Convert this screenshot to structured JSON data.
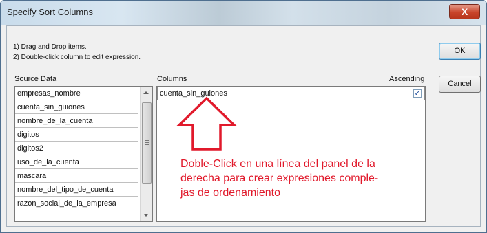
{
  "window": {
    "title": "Specify Sort Columns",
    "close_label": "X"
  },
  "instructions": {
    "line1": "1) Drag and Drop items.",
    "line2": "2) Double-click column to edit expression."
  },
  "buttons": {
    "ok": "OK",
    "cancel": "Cancel"
  },
  "source": {
    "label": "Source Data",
    "items": [
      "empresas_nombre",
      "cuenta_sin_guiones",
      "nombre_de_la_cuenta",
      "digitos",
      "digitos2",
      "uso_de_la_cuenta",
      "mascara",
      "nombre_del_tipo_de_cuenta",
      "razon_social_de_la_empresa"
    ]
  },
  "columns": {
    "label": "Columns",
    "ascending_label": "Ascending",
    "rows": [
      {
        "name": "cuenta_sin_guiones",
        "ascending": true,
        "check_mark": "✓"
      }
    ]
  },
  "annotation": {
    "line1": "Doble-Click en una línea del panel de la",
    "line2": "derecha para crear expresiones comple-",
    "line3": "jas de ordenamiento",
    "color": "#e1192b"
  }
}
